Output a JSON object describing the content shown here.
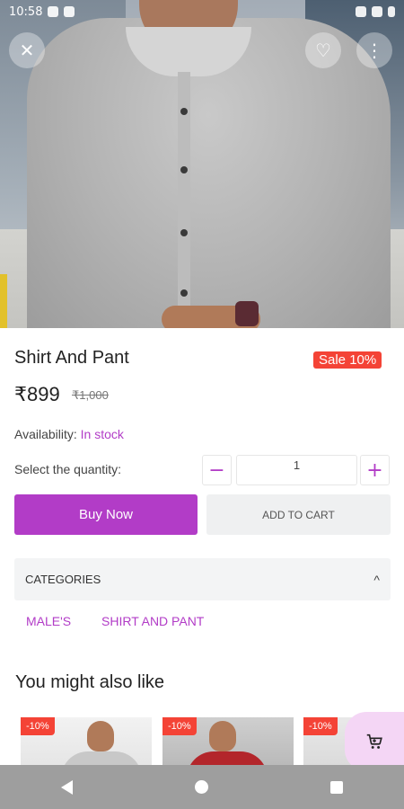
{
  "status_bar": {
    "time": "10:58",
    "icons": [
      "app-icon",
      "sim-icon",
      "wifi-icon",
      "signal-icon",
      "battery-icon"
    ]
  },
  "top_actions": {
    "close_glyph": "✕",
    "favorite_glyph": "♡",
    "more_glyph": "⋮"
  },
  "product": {
    "title": "Shirt And Pant",
    "sale_badge": "Sale 10%",
    "price": "₹899",
    "old_price": "₹1,000",
    "availability_label": "Availability:",
    "availability_value": "In stock",
    "quantity_label": "Select the quantity:",
    "quantity": "1",
    "minus_glyph": "−",
    "plus_glyph": "+"
  },
  "actions": {
    "buy_now": "Buy Now",
    "add_to_cart": "ADD TO CART"
  },
  "categories": {
    "header": "CATEGORIES",
    "chevron": "^",
    "items": [
      "MALE'S",
      "SHIRT AND PANT"
    ]
  },
  "suggestions": {
    "title": "You might also like",
    "cards": [
      {
        "badge": "-10%"
      },
      {
        "badge": "-10%"
      },
      {
        "badge": "-10%"
      }
    ]
  },
  "fab": {
    "icon": "cart-icon"
  },
  "colors": {
    "accent": "#b23cc7",
    "sale": "#f44336",
    "fab_bg": "#f4d6f5",
    "navbar": "#9e9e9e"
  }
}
